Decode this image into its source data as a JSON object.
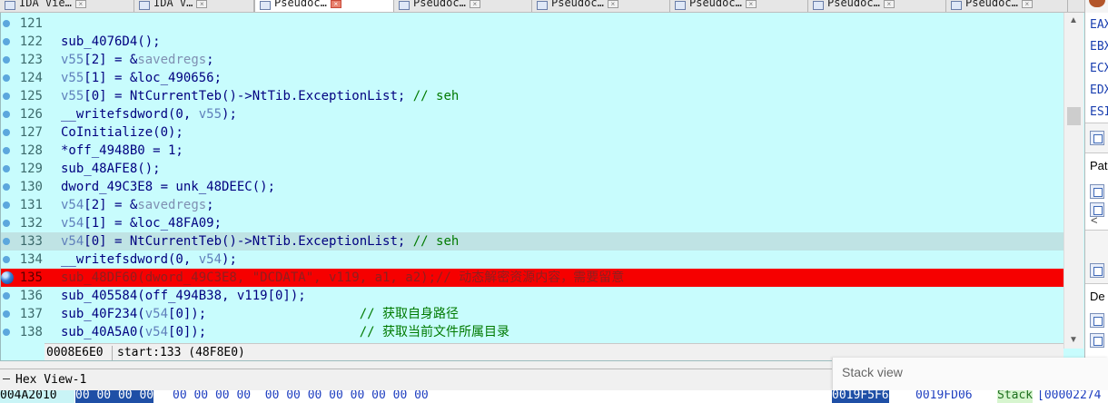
{
  "tabs": [
    {
      "label": "IDA Vie…",
      "active": false
    },
    {
      "label": "IDA V…",
      "active": false
    },
    {
      "label": "Pseudoc…",
      "active": true
    },
    {
      "label": "Pseudoc…",
      "active": false
    },
    {
      "label": "Pseudoc…",
      "active": false
    },
    {
      "label": "Pseudoc…",
      "active": false
    },
    {
      "label": "Pseudoc…",
      "active": false
    },
    {
      "label": "Pseudoc…",
      "active": false
    }
  ],
  "code": [
    {
      "num": "121",
      "parts": []
    },
    {
      "num": "122",
      "parts": [
        {
          "t": "sub_4076D4();",
          "c": "def"
        }
      ]
    },
    {
      "num": "123",
      "parts": [
        {
          "t": "v55",
          "c": "var"
        },
        {
          "t": "[2] = &",
          "c": "def"
        },
        {
          "t": "savedregs",
          "c": "gray"
        },
        {
          "t": ";",
          "c": "def"
        }
      ]
    },
    {
      "num": "124",
      "parts": [
        {
          "t": "v55",
          "c": "var"
        },
        {
          "t": "[1] = &loc_490656;",
          "c": "def"
        }
      ]
    },
    {
      "num": "125",
      "parts": [
        {
          "t": "v55",
          "c": "var"
        },
        {
          "t": "[0] = NtCurrentTeb()->NtTib.ExceptionList; ",
          "c": "def"
        },
        {
          "t": "// seh",
          "c": "cmt"
        }
      ]
    },
    {
      "num": "126",
      "parts": [
        {
          "t": "__writefsdword(0, ",
          "c": "def"
        },
        {
          "t": "v55",
          "c": "var"
        },
        {
          "t": ");",
          "c": "def"
        }
      ]
    },
    {
      "num": "127",
      "parts": [
        {
          "t": "CoInitialize(0);",
          "c": "def"
        }
      ]
    },
    {
      "num": "128",
      "parts": [
        {
          "t": "*off_4948B0 = 1;",
          "c": "def"
        }
      ]
    },
    {
      "num": "129",
      "parts": [
        {
          "t": "sub_48AFE8();",
          "c": "def"
        }
      ]
    },
    {
      "num": "130",
      "parts": [
        {
          "t": "dword_49C3E8 = unk_48DEEC();",
          "c": "def"
        }
      ]
    },
    {
      "num": "131",
      "parts": [
        {
          "t": "v54",
          "c": "var"
        },
        {
          "t": "[2] = &",
          "c": "def"
        },
        {
          "t": "savedregs",
          "c": "gray"
        },
        {
          "t": ";",
          "c": "def"
        }
      ]
    },
    {
      "num": "132",
      "parts": [
        {
          "t": "v54",
          "c": "var"
        },
        {
          "t": "[1] = &loc_48FA09;",
          "c": "def"
        }
      ]
    },
    {
      "num": "133",
      "highlight": true,
      "parts": [
        {
          "t": "v54",
          "c": "var"
        },
        {
          "t": "[0] = NtCurrentTeb()->NtTib.ExceptionList; ",
          "c": "def"
        },
        {
          "t": "// seh",
          "c": "cmt"
        }
      ]
    },
    {
      "num": "134",
      "parts": [
        {
          "t": "__writefsdword(0, ",
          "c": "def"
        },
        {
          "t": "v54",
          "c": "var"
        },
        {
          "t": ");",
          "c": "def"
        }
      ]
    },
    {
      "num": "135",
      "breakpoint": true,
      "parts": [
        {
          "t": "sub_48DF60(dword_49C3E8, \"DCDATA\", v119, a1, a2);// 动态解密资源内容，需要留意",
          "c": "bp"
        }
      ]
    },
    {
      "num": "136",
      "parts": [
        {
          "t": "sub_405584(off_494B38, v119[0]);",
          "c": "def"
        }
      ]
    },
    {
      "num": "137",
      "parts": [
        {
          "t": "sub_40F234(",
          "c": "def"
        },
        {
          "t": "v54",
          "c": "var"
        },
        {
          "t": "[0]);                    ",
          "c": "def"
        },
        {
          "t": "// 获取自身路径",
          "c": "cmt"
        }
      ]
    },
    {
      "num": "138",
      "parts": [
        {
          "t": "sub_40A5A0(",
          "c": "def"
        },
        {
          "t": "v54",
          "c": "var"
        },
        {
          "t": "[0]);                    ",
          "c": "def"
        },
        {
          "t": "// 获取当前文件所属目录",
          "c": "cmt"
        }
      ]
    }
  ],
  "status": {
    "address": "0008E6E0",
    "info": "start:133 (48F8E0)"
  },
  "registers": [
    "EAX",
    "EBX",
    "ECX",
    "EDX",
    "ESI"
  ],
  "side_panels": {
    "panel1_label": "Pat",
    "panel2_label": "De"
  },
  "hex_view": {
    "title": "Hex View-1",
    "address": "004A2010",
    "selected_bytes": "00 00 00 00",
    "rest_bytes": "00 00 00 00  00 00 00 00 00 00 00 00"
  },
  "stack_view": {
    "title": "Stack view",
    "address": "0019F5F6",
    "value": "0019FD06",
    "tag": "Stack",
    "extra": "[00002274"
  }
}
